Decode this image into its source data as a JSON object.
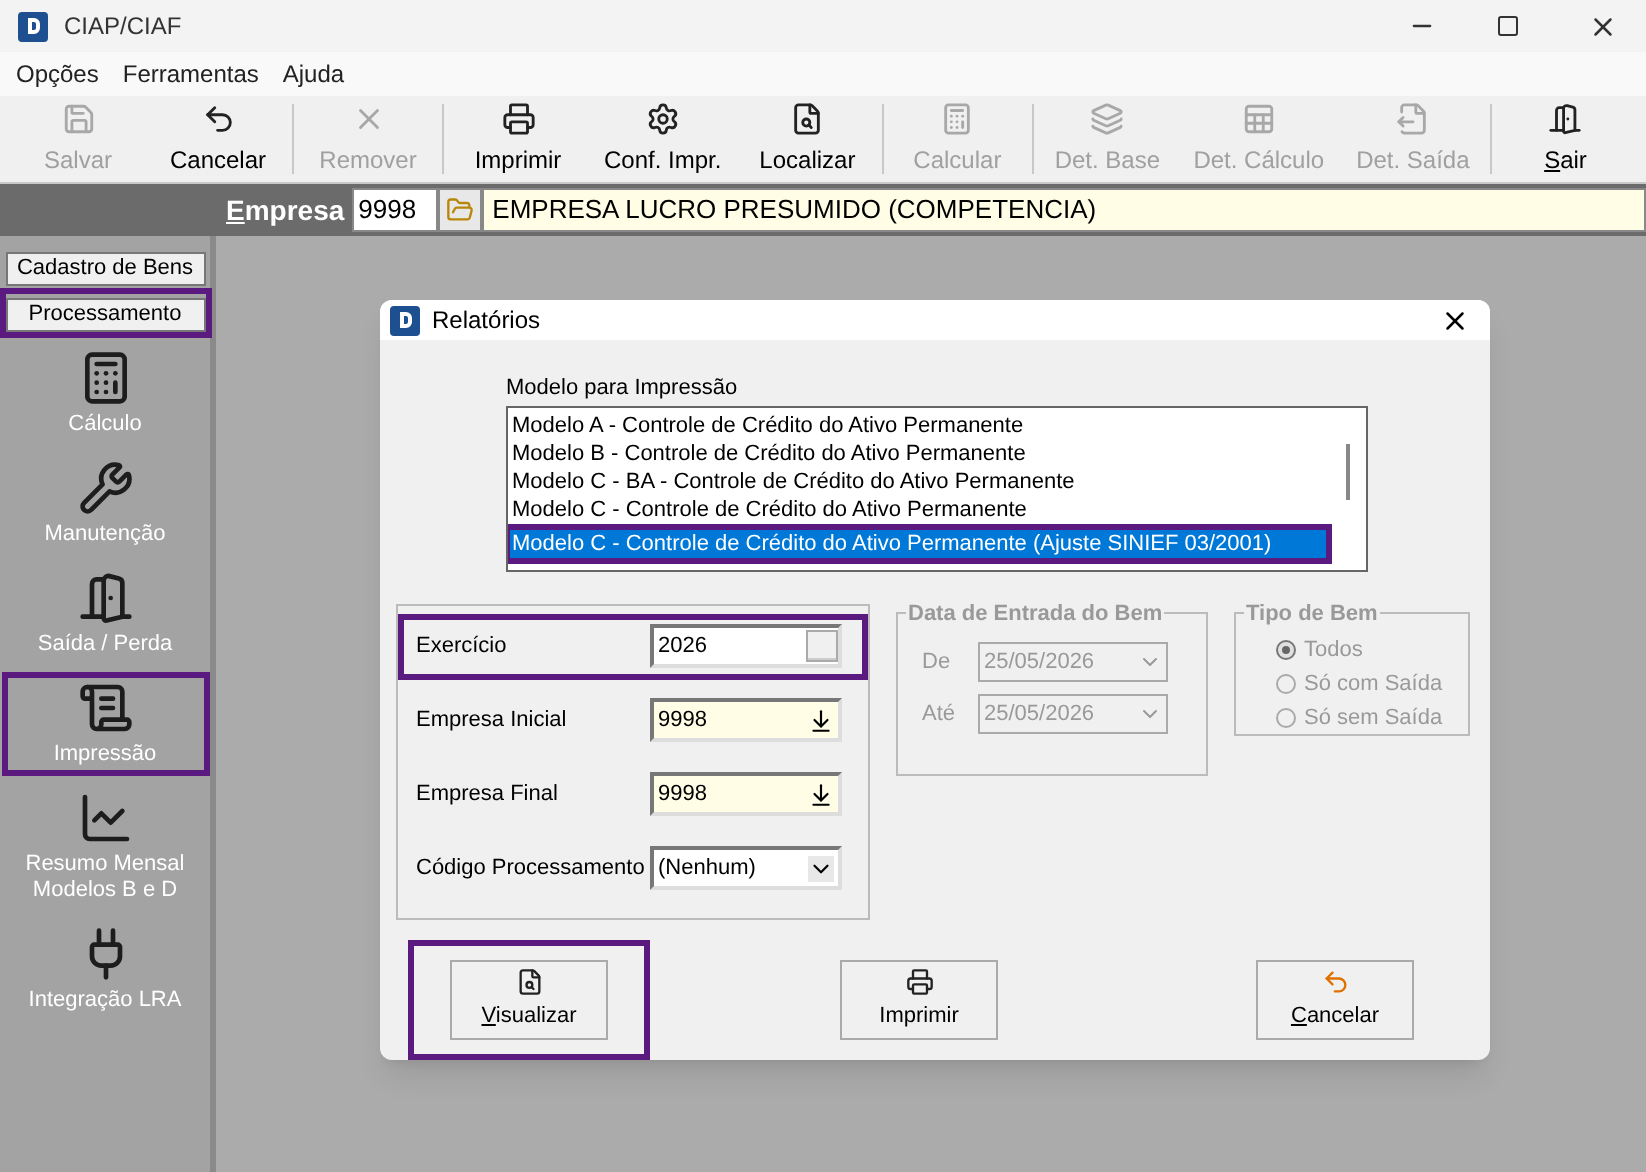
{
  "window": {
    "title": "CIAP/CIAF"
  },
  "menu": [
    "Opções",
    "Ferramentas",
    "Ajuda"
  ],
  "toolbar": [
    {
      "label": "Salvar",
      "disabled": true,
      "underline_first": false
    },
    {
      "label": "Cancelar",
      "disabled": false,
      "underline_first": false
    },
    {
      "label": "Remover",
      "disabled": true,
      "underline_first": false
    },
    {
      "label": "Imprimir",
      "disabled": false,
      "underline_first": false
    },
    {
      "label": "Conf. Impr.",
      "disabled": false,
      "underline_first": false
    },
    {
      "label": "Localizar",
      "disabled": false,
      "underline_first": false
    },
    {
      "label": "Calcular",
      "disabled": true,
      "underline_first": false
    },
    {
      "label": "Det. Base",
      "disabled": true,
      "underline_first": false
    },
    {
      "label": "Det. Cálculo",
      "disabled": true,
      "underline_first": false
    },
    {
      "label": "Det. Saída",
      "disabled": true,
      "underline_first": false
    },
    {
      "label": "Sair",
      "disabled": false,
      "underline_first": true
    }
  ],
  "company_bar": {
    "label": "Empresa",
    "code": "9998",
    "name": "EMPRESA LUCRO PRESUMIDO (COMPETENCIA)"
  },
  "sidebar": {
    "tabs": [
      {
        "label": "Cadastro de Bens",
        "highlighted": false
      },
      {
        "label": "Processamento",
        "highlighted": true
      }
    ],
    "items": [
      {
        "label": "Cálculo",
        "highlighted": false
      },
      {
        "label": "Manutenção",
        "highlighted": false
      },
      {
        "label": "Saída / Perda",
        "highlighted": false
      },
      {
        "label": "Impressão",
        "highlighted": true
      },
      {
        "label": "Resumo Mensal Modelos B e D",
        "highlighted": false
      },
      {
        "label": "Integração LRA",
        "highlighted": false
      }
    ]
  },
  "dialog": {
    "title": "Relatórios",
    "list_label": "Modelo para Impressão",
    "models": [
      {
        "label": "Modelo A - Controle de Crédito do Ativo Permanente",
        "selected": false,
        "highlighted": false
      },
      {
        "label": "Modelo B - Controle de Crédito do Ativo Permanente",
        "selected": false,
        "highlighted": false
      },
      {
        "label": "Modelo C - BA -  Controle de Crédito do Ativo Permanente",
        "selected": false,
        "highlighted": false
      },
      {
        "label": "Modelo C - Controle de Crédito do Ativo Permanente",
        "selected": false,
        "highlighted": false
      },
      {
        "label": "Modelo C - Controle de Crédito do Ativo Permanente (Ajuste SINIEF 03/2001)",
        "selected": true,
        "highlighted": true
      }
    ],
    "fields": [
      {
        "label": "Exercício",
        "value": "2026",
        "kind": "spin",
        "highlighted": true
      },
      {
        "label": "Empresa Inicial",
        "value": "9998",
        "kind": "lookup",
        "highlighted": false
      },
      {
        "label": "Empresa Final",
        "value": "9998",
        "kind": "lookup",
        "highlighted": false
      },
      {
        "label": "Código Processamento",
        "value": "(Nenhum)",
        "kind": "combo",
        "highlighted": false
      }
    ],
    "date_group": {
      "title": "Data de Entrada do Bem",
      "disabled": true,
      "rows": [
        {
          "label": "De",
          "value": "25/05/2026"
        },
        {
          "label": "Até",
          "value": "25/05/2026"
        }
      ]
    },
    "type_group": {
      "title": "Tipo de Bem",
      "disabled": true,
      "options": [
        {
          "label": "Todos",
          "selected": true
        },
        {
          "label": "Só com Saída",
          "selected": false
        },
        {
          "label": "Só sem Saída",
          "selected": false
        }
      ]
    },
    "buttons": [
      {
        "label": "Visualizar",
        "underline_first": true,
        "highlighted": true
      },
      {
        "label": "Imprimir",
        "underline_first": false,
        "highlighted": false
      },
      {
        "label": "Cancelar",
        "underline_first": true,
        "highlighted": false
      }
    ]
  }
}
